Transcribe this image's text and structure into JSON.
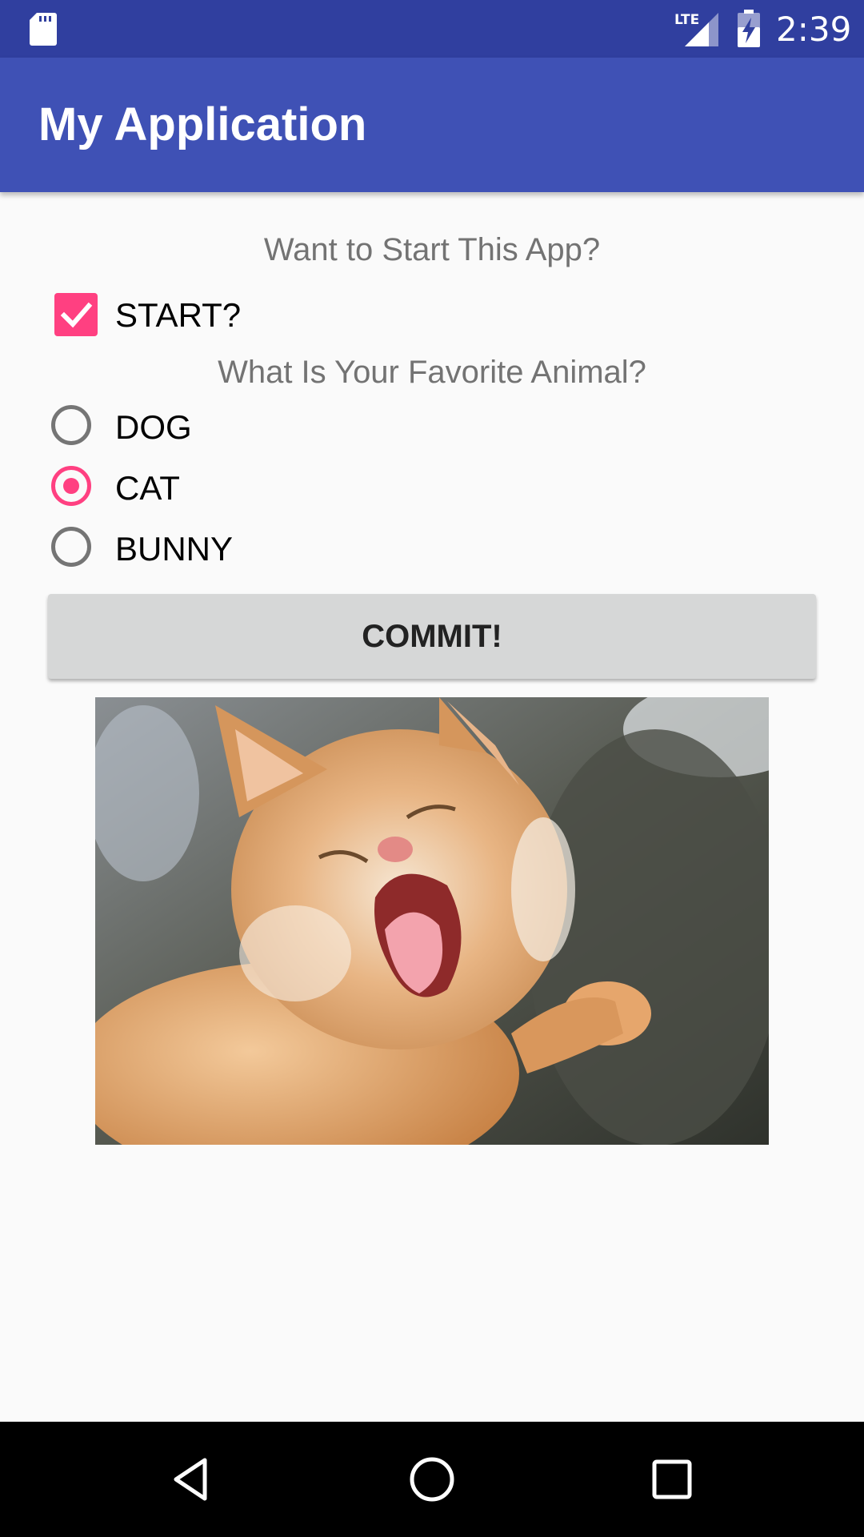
{
  "status_bar": {
    "time": "2:39",
    "network": "LTE",
    "icons": [
      "sd-card-icon",
      "lte-signal-icon",
      "battery-charging-icon"
    ]
  },
  "app_bar": {
    "title": "My Application",
    "color": "#3f51b5",
    "status_color": "#303f9f"
  },
  "form": {
    "start_question": "Want to Start This App?",
    "start_checkbox": {
      "label": "START?",
      "checked": true
    },
    "animal_question": "What Is Your Favorite Animal?",
    "animal_options": [
      {
        "label": "DOG",
        "selected": false
      },
      {
        "label": "CAT",
        "selected": true
      },
      {
        "label": "BUNNY",
        "selected": false
      }
    ],
    "commit_label": "COMMIT!",
    "accent_color": "#ff4081"
  },
  "image": {
    "subject": "yawning orange kitten",
    "icon": "cat-photo"
  },
  "nav_bar": {
    "icons": [
      "back-icon",
      "home-icon",
      "recents-icon"
    ]
  }
}
